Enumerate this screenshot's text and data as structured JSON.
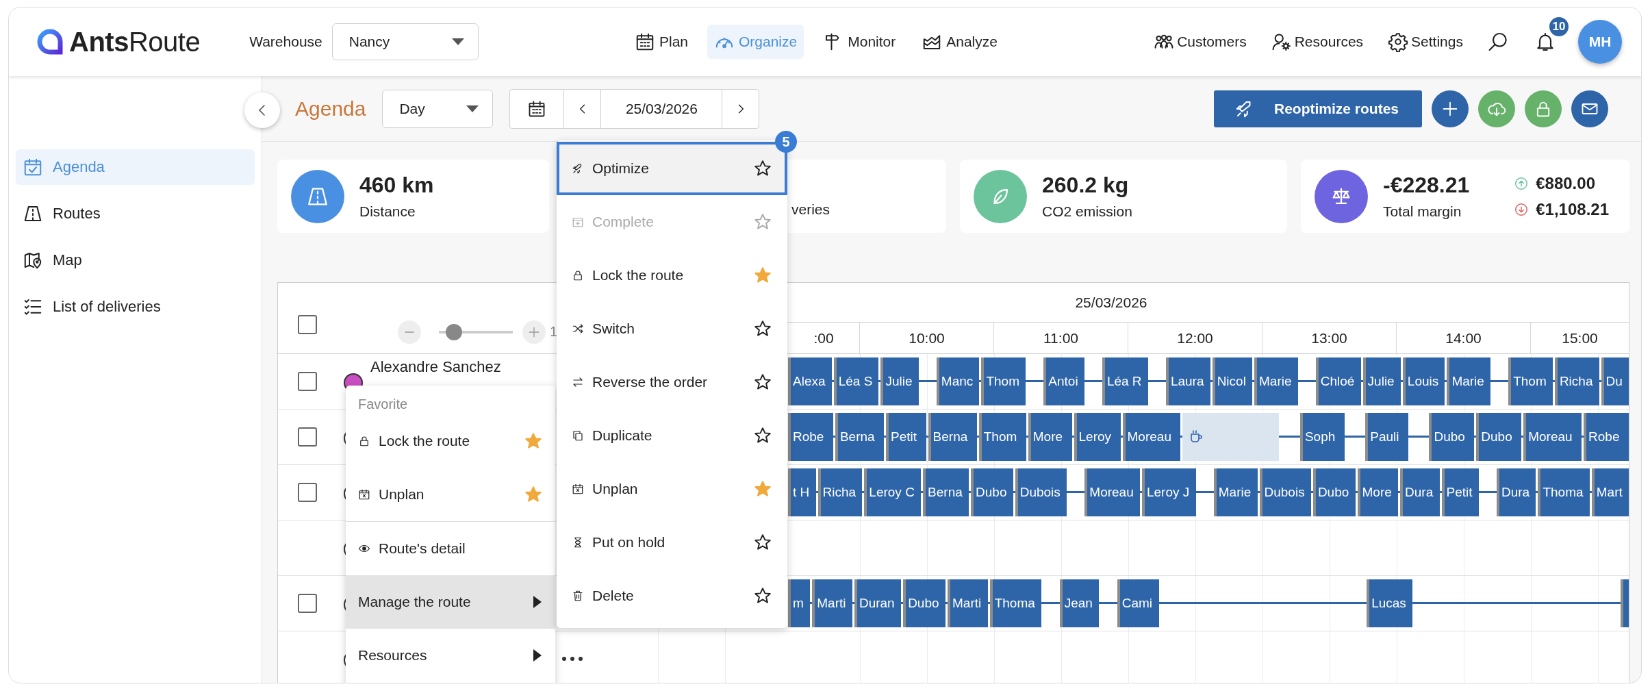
{
  "header": {
    "logo": "**Ants**Route",
    "warehouse_label": "Warehouse",
    "warehouse_value": "Nancy",
    "nav": [
      {
        "label": "Plan",
        "selected": false
      },
      {
        "label": "Organize",
        "selected": true
      },
      {
        "label": "Monitor",
        "selected": false
      },
      {
        "label": "Analyze",
        "selected": false
      }
    ],
    "links": [
      "Customers",
      "Resources",
      "Settings"
    ],
    "notification_count": "10",
    "avatar": "MH"
  },
  "sidebar": {
    "items": [
      {
        "label": "Agenda",
        "selected": true
      },
      {
        "label": "Routes",
        "selected": false
      },
      {
        "label": "Map",
        "selected": false
      },
      {
        "label": "List of deliveries",
        "selected": false
      }
    ]
  },
  "toolbar": {
    "title": "Agenda",
    "view": "Day",
    "date": "25/03/2026",
    "reoptimize": "Reoptimize routes"
  },
  "stats": [
    {
      "kind": "metric",
      "value": "460 km",
      "label": "Distance"
    },
    {
      "kind": "covered",
      "label": "veries"
    },
    {
      "kind": "metric",
      "value": "260.2 kg",
      "label": "CO2 emission"
    },
    {
      "kind": "margin",
      "value": "-€228.21",
      "label": "Total margin",
      "income": "€880.00",
      "cost": "€1,108.21"
    }
  ],
  "gantt": {
    "date": "25/03/2026",
    "hours": [
      ":00",
      "10:00",
      "11:00",
      "12:00",
      "13:00",
      "14:00",
      "15:00"
    ],
    "header_checked": false,
    "zoom": {
      "level": 0.2,
      "reading": "1"
    },
    "rows": [
      {
        "name": "Alexandre Sanchez",
        "color": "#c94ec2",
        "checked": false,
        "stops": [
          {
            "kind": "stop",
            "label": "Alexa"
          },
          {
            "kind": "stop",
            "label": "Léa S"
          },
          {
            "kind": "stop",
            "label": "Julie"
          },
          {
            "kind": "wait"
          },
          {
            "kind": "stop",
            "label": "Manc"
          },
          {
            "kind": "stop",
            "label": "Thom"
          },
          {
            "kind": "wait"
          },
          {
            "kind": "stop",
            "label": "Antoi"
          },
          {
            "kind": "wait"
          },
          {
            "kind": "stop",
            "label": "Léa R"
          },
          {
            "kind": "wait"
          },
          {
            "kind": "stop",
            "label": "Laura"
          },
          {
            "kind": "stop",
            "label": "Nicol"
          },
          {
            "kind": "stop",
            "label": "Marie"
          },
          {
            "kind": "wait"
          },
          {
            "kind": "stop",
            "label": "Chloé"
          },
          {
            "kind": "stop",
            "label": "Julie"
          },
          {
            "kind": "stop",
            "label": "Louis"
          },
          {
            "kind": "stop",
            "label": "Marie"
          },
          {
            "kind": "wait"
          },
          {
            "kind": "stop",
            "label": "Thom"
          },
          {
            "kind": "stop",
            "label": "Richa"
          },
          {
            "kind": "stop",
            "label": "Du"
          }
        ]
      },
      {
        "checked": false,
        "stops": [
          {
            "kind": "stop",
            "label": "Robe"
          },
          {
            "kind": "stop",
            "label": "Berna"
          },
          {
            "kind": "stop",
            "label": "Petit"
          },
          {
            "kind": "stop",
            "label": "Berna"
          },
          {
            "kind": "stop",
            "label": "Thom"
          },
          {
            "kind": "stop",
            "label": "More"
          },
          {
            "kind": "stop",
            "label": "Leroy"
          },
          {
            "kind": "stop",
            "label": "Moreau"
          },
          {
            "kind": "break"
          },
          {
            "kind": "wait"
          },
          {
            "kind": "stop",
            "label": "Soph"
          },
          {
            "kind": "wait"
          },
          {
            "kind": "stop",
            "label": "Pauli"
          },
          {
            "kind": "wait"
          },
          {
            "kind": "stop",
            "label": "Dubo"
          },
          {
            "kind": "stop",
            "label": "Dubo"
          },
          {
            "kind": "stop",
            "label": "Moreau"
          },
          {
            "kind": "stop",
            "label": "Robe"
          }
        ]
      },
      {
        "checked": false,
        "stops": [
          {
            "kind": "stop",
            "label": "t H"
          },
          {
            "kind": "stop",
            "label": "Richa"
          },
          {
            "kind": "stop",
            "label": "Leroy C"
          },
          {
            "kind": "stop",
            "label": "Berna"
          },
          {
            "kind": "stop",
            "label": "Dubo"
          },
          {
            "kind": "stop",
            "label": "Dubois"
          },
          {
            "kind": "wait"
          },
          {
            "kind": "stop",
            "label": "Moreau"
          },
          {
            "kind": "stop",
            "label": "Leroy J"
          },
          {
            "kind": "wait"
          },
          {
            "kind": "stop",
            "label": "Marie"
          },
          {
            "kind": "stop",
            "label": "Dubois"
          },
          {
            "kind": "stop",
            "label": "Dubo"
          },
          {
            "kind": "stop",
            "label": "More"
          },
          {
            "kind": "stop",
            "label": "Dura"
          },
          {
            "kind": "stop",
            "label": "Petit"
          },
          {
            "kind": "wait"
          },
          {
            "kind": "stop",
            "label": "Dura"
          },
          {
            "kind": "stop",
            "label": "Thoma"
          },
          {
            "kind": "stop",
            "label": "Mart"
          }
        ]
      },
      {
        "stops": []
      },
      {
        "checked": false,
        "stops": [
          {
            "kind": "stop",
            "label": "m"
          },
          {
            "kind": "stop",
            "label": "Marti"
          },
          {
            "kind": "stop",
            "label": "Duran"
          },
          {
            "kind": "stop",
            "label": "Dubo"
          },
          {
            "kind": "stop",
            "label": "Marti"
          },
          {
            "kind": "stop",
            "label": "Thoma"
          },
          {
            "kind": "wait"
          },
          {
            "kind": "stop",
            "label": "Jean"
          },
          {
            "kind": "wait"
          },
          {
            "kind": "stop",
            "label": "Cami"
          },
          {
            "kind": "idle"
          },
          {
            "kind": "stop",
            "label": "Lucas"
          },
          {
            "kind": "idle"
          },
          {
            "kind": "stop"
          }
        ]
      },
      {
        "stops": []
      }
    ]
  },
  "route_menu": {
    "section": "Favorite",
    "favorites": [
      {
        "label": "Lock the route",
        "starred": true
      },
      {
        "label": "Unplan",
        "starred": true
      }
    ],
    "items": [
      {
        "label": "Route's detail",
        "selected": false,
        "submenu": false
      },
      {
        "label": "Manage the route",
        "selected": true,
        "submenu": true
      },
      {
        "label": "Resources",
        "selected": false,
        "submenu": true
      }
    ]
  },
  "manage_menu": {
    "badge": "5",
    "items": [
      {
        "label": "Optimize",
        "selected": true,
        "disabled": false,
        "starred": false
      },
      {
        "label": "Complete",
        "selected": false,
        "disabled": true,
        "starred": false
      },
      {
        "label": "Lock the route",
        "selected": false,
        "disabled": false,
        "starred": true
      },
      {
        "label": "Switch",
        "selected": false,
        "disabled": false,
        "starred": false
      },
      {
        "label": "Reverse the order",
        "selected": false,
        "disabled": false,
        "starred": false
      },
      {
        "label": "Duplicate",
        "selected": false,
        "disabled": false,
        "starred": false
      },
      {
        "label": "Unplan",
        "selected": false,
        "disabled": false,
        "starred": true
      },
      {
        "label": "Put on hold",
        "selected": false,
        "disabled": false,
        "starred": false
      },
      {
        "label": "Delete",
        "selected": false,
        "disabled": false,
        "starred": false
      }
    ]
  }
}
